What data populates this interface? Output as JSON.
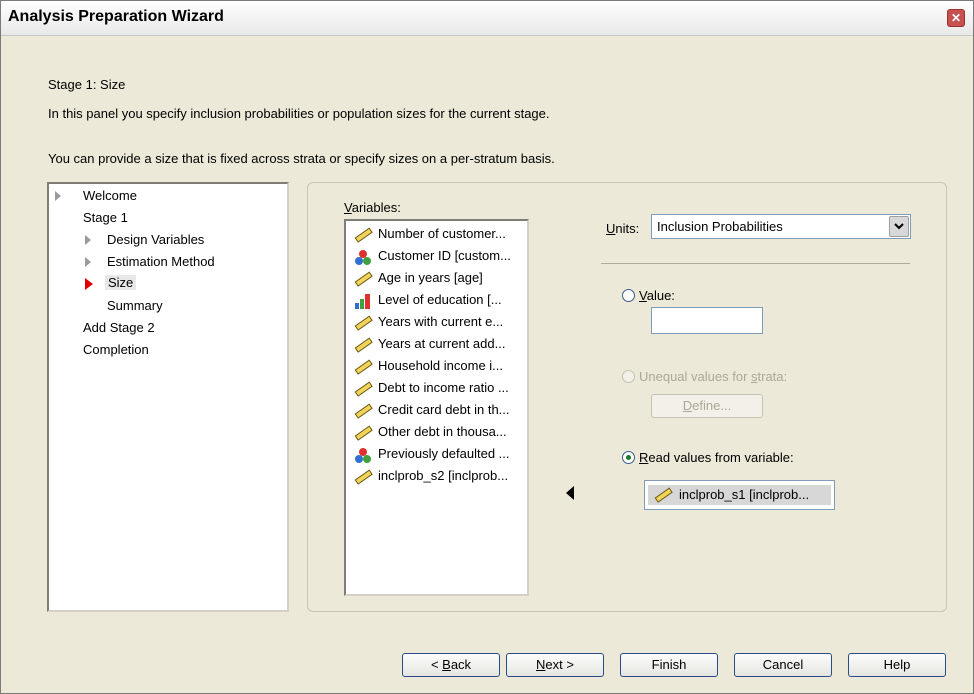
{
  "window": {
    "title": "Analysis Preparation Wizard"
  },
  "header": {
    "stage_title": "Stage 1: Size",
    "description": "In this panel you specify inclusion probabilities or population sizes for the current stage.",
    "note": "You can provide a size that is fixed across strata or specify sizes on a per-stratum basis."
  },
  "nav": {
    "items": [
      {
        "label": "Welcome"
      },
      {
        "label": "Stage 1"
      },
      {
        "label": "Design Variables"
      },
      {
        "label": "Estimation Method"
      },
      {
        "label": "Size"
      },
      {
        "label": "Summary"
      },
      {
        "label": "Add Stage 2"
      },
      {
        "label": "Completion"
      }
    ]
  },
  "variables": {
    "label_prefix": "V",
    "label_rest": "ariables:",
    "items": [
      {
        "label": "Number of customer...",
        "icon": "scale-ruler-icon"
      },
      {
        "label": "Customer ID [custom...",
        "icon": "nominal-icon"
      },
      {
        "label": "Age in years [age]",
        "icon": "scale-ruler-icon"
      },
      {
        "label": "Level of education [...",
        "icon": "ordinal-bar-icon"
      },
      {
        "label": "Years with current e...",
        "icon": "scale-ruler-icon"
      },
      {
        "label": "Years at current add...",
        "icon": "scale-ruler-icon"
      },
      {
        "label": "Household income i...",
        "icon": "scale-ruler-icon"
      },
      {
        "label": "Debt to income ratio ...",
        "icon": "scale-ruler-icon"
      },
      {
        "label": "Credit card debt in th...",
        "icon": "scale-ruler-icon"
      },
      {
        "label": "Other debt in thousa...",
        "icon": "scale-ruler-icon"
      },
      {
        "label": "Previously defaulted ...",
        "icon": "nominal-icon"
      },
      {
        "label": "inclprob_s2 [inclprob...",
        "icon": "scale-ruler-icon"
      }
    ]
  },
  "units": {
    "label_prefix": "U",
    "label_rest": "nits:",
    "selected": "Inclusion Probabilities"
  },
  "options": {
    "value_prefix": "V",
    "value_rest": "alue:",
    "value_input": "",
    "unequal_label_a": "Unequal values for ",
    "unequal_label_s": "s",
    "unequal_label_b": "trata:",
    "define_prefix": "D",
    "define_rest": "efine...",
    "read_prefix": "R",
    "read_rest": "ead values from variable:",
    "read_variable": "inclprob_s1 [inclprob...",
    "selected_option": "read"
  },
  "buttons": {
    "back_arrow": "< ",
    "back_prefix": "B",
    "back_rest": "ack",
    "next_prefix": "N",
    "next_rest": "ext >",
    "finish": "Finish",
    "cancel": "Cancel",
    "help": "Help"
  },
  "colors": {
    "background": "#ece9d8",
    "current_step_marker": "#e00000",
    "selected_radio": "#1a7a2a"
  }
}
